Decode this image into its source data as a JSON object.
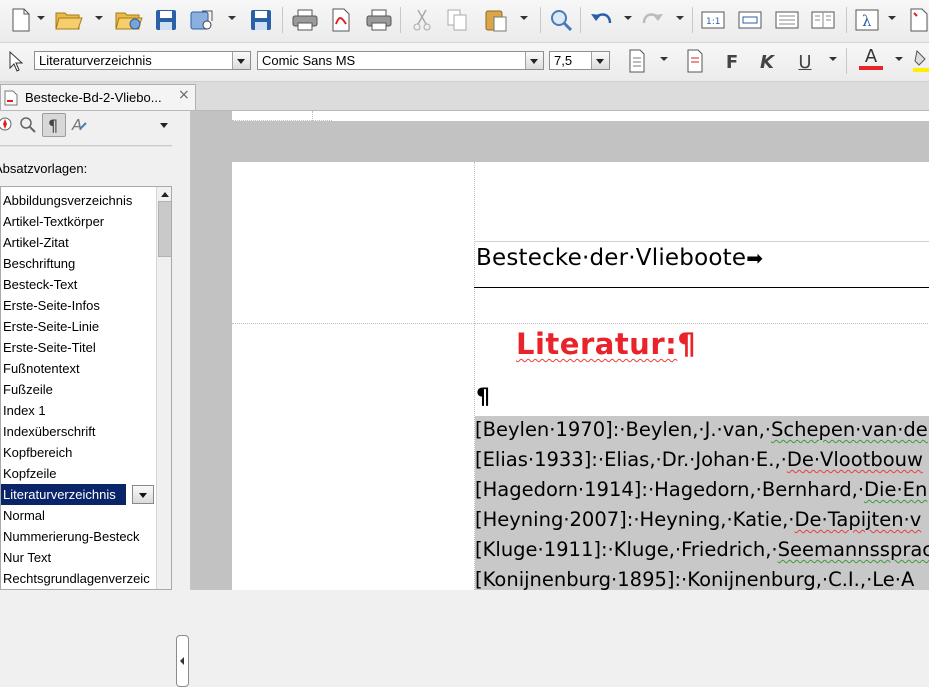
{
  "toolbar_standard": {
    "icons": [
      "new-document-icon",
      "open-folder-icon",
      "recent-folder-icon",
      "save-icon",
      "save-remote-icon",
      "save-as-icon",
      "print-icon",
      "export-pdf-icon",
      "print-preview-icon",
      "cut-icon",
      "copy-icon",
      "paste-icon",
      "find-replace-icon",
      "undo-icon",
      "redo-icon",
      "field-icon",
      "text-box-icon",
      "page-icon",
      "columns-icon",
      "lambda-formula-icon",
      "extension-icon"
    ]
  },
  "toolbar_formatting": {
    "paragraph_style": "Literaturverzeichnis",
    "font_name": "Comic Sans MS",
    "font_size": "7,5",
    "bold_label": "F",
    "italic_label": "K",
    "underline_label": "U",
    "font_color_label": "A",
    "font_color": "#e8232a"
  },
  "tab": {
    "label": "Bestecke-Bd-2-Vliebo...",
    "close_symbol": "×"
  },
  "sidebar": {
    "section_title": "Absatzvorlagen:",
    "styles": [
      "Abbildungsverzeichnis",
      "Artikel-Textkörper",
      "Artikel-Zitat",
      "Beschriftung",
      "Besteck-Text",
      "Erste-Seite-Infos",
      "Erste-Seite-Linie",
      "Erste-Seite-Titel",
      "Fußnotentext",
      "Fußzeile",
      "Index 1",
      "Indexüberschrift",
      "Kopfbereich",
      "Kopfzeile",
      "Literaturverzeichnis",
      "Normal",
      "Nummerierung-Besteck",
      "Nur Text",
      "Rechtsgrundlagenverzeic"
    ],
    "selected_index": 14,
    "selection_color": "#0a246a"
  },
  "document": {
    "header_text": "Bestecke·der·Vlieboote",
    "header_tab_arrow": "➡",
    "heading_word": "Literatur:",
    "pilcrow": "¶",
    "heading_color": "#e8232a",
    "references": [
      {
        "key": "[Beylen·1970]:·",
        "author": "Beylen,·J.·van,·",
        "title": "Schepen·van·de"
      },
      {
        "key": "[Elias·1933]:·",
        "author": "Elias,·Dr.·Johan·E.,·",
        "title": "De·Vlootbouw"
      },
      {
        "key": "[Hagedorn·1914]:·",
        "author": "Hagedorn,·Bernhard,·",
        "title": "Die·En"
      },
      {
        "key": "[Heyning·2007]:·",
        "author": "Heyning,·Katie,·",
        "title": "De·Tapijten·v"
      },
      {
        "key": "[Kluge·1911]:·",
        "author": "Kluge,·Friedrich,·",
        "title": "Seemannssprac"
      },
      {
        "key": "[Konijnenburg·1895]:·",
        "author": "Konijnenburg,·C.I.,·",
        "title": "Le·A"
      }
    ]
  }
}
